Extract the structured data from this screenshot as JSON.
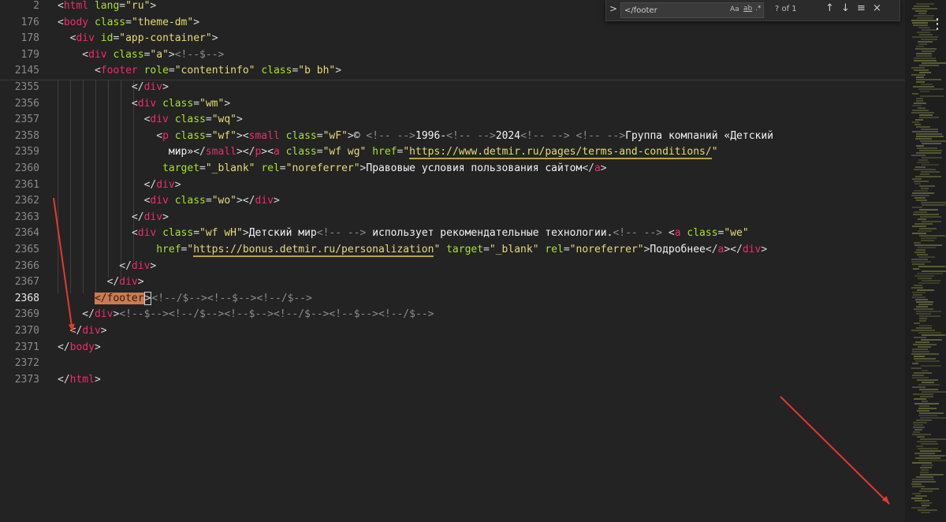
{
  "find": {
    "query": "</footer",
    "toggle": ">",
    "match_case": "Aa",
    "whole_word": "ab",
    "regex": ".*",
    "count": "? of 1",
    "prev": "↑",
    "next": "↓",
    "selection": "≡",
    "close": "×"
  },
  "menu_icon": "⋮",
  "lines": [
    {
      "n": "2",
      "t": [
        [
          "p",
          "<"
        ],
        [
          "t",
          "html "
        ],
        [
          "a",
          "lang"
        ],
        [
          "p",
          "="
        ],
        [
          "s",
          "\"ru\""
        ],
        [
          "p",
          ">"
        ]
      ]
    },
    {
      "n": "176",
      "t": [
        [
          "p",
          "<"
        ],
        [
          "t",
          "body "
        ],
        [
          "a",
          "class"
        ],
        [
          "p",
          "="
        ],
        [
          "s",
          "\"theme-dm\""
        ],
        [
          "p",
          ">"
        ]
      ]
    },
    {
      "n": "178",
      "t": [
        [
          "p",
          "  <"
        ],
        [
          "t",
          "div "
        ],
        [
          "a",
          "id"
        ],
        [
          "p",
          "="
        ],
        [
          "s",
          "\"app-container\""
        ],
        [
          "p",
          ">"
        ]
      ]
    },
    {
      "n": "179",
      "t": [
        [
          "p",
          "    <"
        ],
        [
          "t",
          "div "
        ],
        [
          "a",
          "class"
        ],
        [
          "p",
          "="
        ],
        [
          "s",
          "\"a\""
        ],
        [
          "p",
          ">"
        ],
        [
          "c",
          "<!--$-->"
        ]
      ]
    },
    {
      "n": "2145",
      "t": [
        [
          "p",
          "      <"
        ],
        [
          "t",
          "footer "
        ],
        [
          "a",
          "role"
        ],
        [
          "p",
          "="
        ],
        [
          "s",
          "\"contentinfo\" "
        ],
        [
          "a",
          "class"
        ],
        [
          "p",
          "="
        ],
        [
          "s",
          "\"b bh\""
        ],
        [
          "p",
          ">"
        ]
      ]
    },
    {
      "n": "2355",
      "t": [
        [
          "p",
          "            </"
        ],
        [
          "t",
          "div"
        ],
        [
          "p",
          ">"
        ]
      ]
    },
    {
      "n": "2356",
      "t": [
        [
          "p",
          "            <"
        ],
        [
          "t",
          "div "
        ],
        [
          "a",
          "class"
        ],
        [
          "p",
          "="
        ],
        [
          "s",
          "\"wm\""
        ],
        [
          "p",
          ">"
        ]
      ]
    },
    {
      "n": "2357",
      "t": [
        [
          "p",
          "              <"
        ],
        [
          "t",
          "div "
        ],
        [
          "a",
          "class"
        ],
        [
          "p",
          "="
        ],
        [
          "s",
          "\"wq\""
        ],
        [
          "p",
          ">"
        ]
      ]
    },
    {
      "n": "2358",
      "t": [
        [
          "p",
          "                <"
        ],
        [
          "t",
          "p "
        ],
        [
          "a",
          "class"
        ],
        [
          "p",
          "="
        ],
        [
          "s",
          "\"wf\""
        ],
        [
          "p",
          ">"
        ],
        [
          "p",
          "<"
        ],
        [
          "t",
          "small "
        ],
        [
          "a",
          "class"
        ],
        [
          "p",
          "="
        ],
        [
          "s",
          "\"wF\""
        ],
        [
          "p",
          ">"
        ],
        [
          "x",
          "© "
        ],
        [
          "c",
          "<!-- -->"
        ],
        [
          "x",
          "1996-"
        ],
        [
          "c",
          "<!-- -->"
        ],
        [
          "x",
          "2024"
        ],
        [
          "c",
          "<!-- --> <!-- -->"
        ],
        [
          "x",
          "Группа компаний «Детский"
        ]
      ]
    },
    {
      "n": "2359",
      "t": [
        [
          "x",
          "                  мир»"
        ],
        [
          "p",
          "</"
        ],
        [
          "t",
          "small"
        ],
        [
          "p",
          ">"
        ],
        [
          "p",
          "</"
        ],
        [
          "t",
          "p"
        ],
        [
          "p",
          ">"
        ],
        [
          "p",
          "<"
        ],
        [
          "t",
          "a "
        ],
        [
          "a",
          "class"
        ],
        [
          "p",
          "="
        ],
        [
          "s",
          "\"wf wg\" "
        ],
        [
          "a",
          "href"
        ],
        [
          "p",
          "="
        ],
        [
          "s",
          "\""
        ],
        [
          "link",
          "https://www.detmir.ru/pages/terms-and-conditions/"
        ],
        [
          "s",
          "\""
        ]
      ]
    },
    {
      "n": "2360",
      "t": [
        [
          "p",
          "                 "
        ],
        [
          "a",
          "target"
        ],
        [
          "p",
          "="
        ],
        [
          "s",
          "\"_blank\" "
        ],
        [
          "a",
          "rel"
        ],
        [
          "p",
          "="
        ],
        [
          "s",
          "\"noreferrer\""
        ],
        [
          "p",
          ">"
        ],
        [
          "x",
          "Правовые условия пользования сайтом"
        ],
        [
          "p",
          "</"
        ],
        [
          "t",
          "a"
        ],
        [
          "p",
          ">"
        ]
      ]
    },
    {
      "n": "2361",
      "t": [
        [
          "p",
          "              </"
        ],
        [
          "t",
          "div"
        ],
        [
          "p",
          ">"
        ]
      ]
    },
    {
      "n": "2362",
      "t": [
        [
          "p",
          "              <"
        ],
        [
          "t",
          "div "
        ],
        [
          "a",
          "class"
        ],
        [
          "p",
          "="
        ],
        [
          "s",
          "\"wo\""
        ],
        [
          "p",
          ">"
        ],
        [
          "p",
          "</"
        ],
        [
          "t",
          "div"
        ],
        [
          "p",
          ">"
        ]
      ]
    },
    {
      "n": "2363",
      "t": [
        [
          "p",
          "            </"
        ],
        [
          "t",
          "div"
        ],
        [
          "p",
          ">"
        ]
      ]
    },
    {
      "n": "2364",
      "t": [
        [
          "p",
          "            <"
        ],
        [
          "t",
          "div "
        ],
        [
          "a",
          "class"
        ],
        [
          "p",
          "="
        ],
        [
          "s",
          "\"wf wH\""
        ],
        [
          "p",
          ">"
        ],
        [
          "x",
          "Детский мир"
        ],
        [
          "c",
          "<!-- -->"
        ],
        [
          "x",
          " использует рекомендательные технологии."
        ],
        [
          "c",
          "<!-- -->"
        ],
        [
          "x",
          " "
        ],
        [
          "p",
          "<"
        ],
        [
          "t",
          "a "
        ],
        [
          "a",
          "class"
        ],
        [
          "p",
          "="
        ],
        [
          "s",
          "\"we\""
        ]
      ]
    },
    {
      "n": "2365",
      "t": [
        [
          "p",
          "                "
        ],
        [
          "a",
          "href"
        ],
        [
          "p",
          "="
        ],
        [
          "s",
          "\""
        ],
        [
          "link",
          "https://bonus.detmir.ru/personalization"
        ],
        [
          "s",
          "\" "
        ],
        [
          "a",
          "target"
        ],
        [
          "p",
          "="
        ],
        [
          "s",
          "\"_blank\" "
        ],
        [
          "a",
          "rel"
        ],
        [
          "p",
          "="
        ],
        [
          "s",
          "\"noreferrer\""
        ],
        [
          "p",
          ">"
        ],
        [
          "x",
          "Подробнее"
        ],
        [
          "p",
          "</"
        ],
        [
          "t",
          "a"
        ],
        [
          "p",
          ">"
        ],
        [
          "p",
          "</"
        ],
        [
          "t",
          "div"
        ],
        [
          "p",
          ">"
        ]
      ]
    },
    {
      "n": "2366",
      "t": [
        [
          "p",
          "          </"
        ],
        [
          "t",
          "div"
        ],
        [
          "p",
          ">"
        ]
      ]
    },
    {
      "n": "2367",
      "t": [
        [
          "p",
          "        </"
        ],
        [
          "t",
          "div"
        ],
        [
          "p",
          ">"
        ]
      ]
    },
    {
      "n": "2368",
      "active": true,
      "t": [
        [
          "p",
          "      "
        ],
        [
          "hl",
          "</footer"
        ],
        [
          "hlb",
          ">"
        ],
        [
          "c",
          "<!--/$--><!--$--><!--/$-->"
        ]
      ]
    },
    {
      "n": "2369",
      "t": [
        [
          "p",
          "    </"
        ],
        [
          "t",
          "div"
        ],
        [
          "p",
          ">"
        ],
        [
          "c",
          "<!--$--><!--/$--><!--$--><!--/$--><!--$--><!--/$-->"
        ]
      ]
    },
    {
      "n": "2370",
      "t": [
        [
          "p",
          "  </"
        ],
        [
          "t",
          "div"
        ],
        [
          "p",
          ">"
        ]
      ]
    },
    {
      "n": "2371",
      "t": [
        [
          "p",
          "</"
        ],
        [
          "t",
          "body"
        ],
        [
          "p",
          ">"
        ]
      ]
    },
    {
      "n": "2372",
      "t": []
    },
    {
      "n": "2373",
      "t": [
        [
          "p",
          "</"
        ],
        [
          "t",
          "html"
        ],
        [
          "p",
          ">"
        ]
      ]
    }
  ]
}
